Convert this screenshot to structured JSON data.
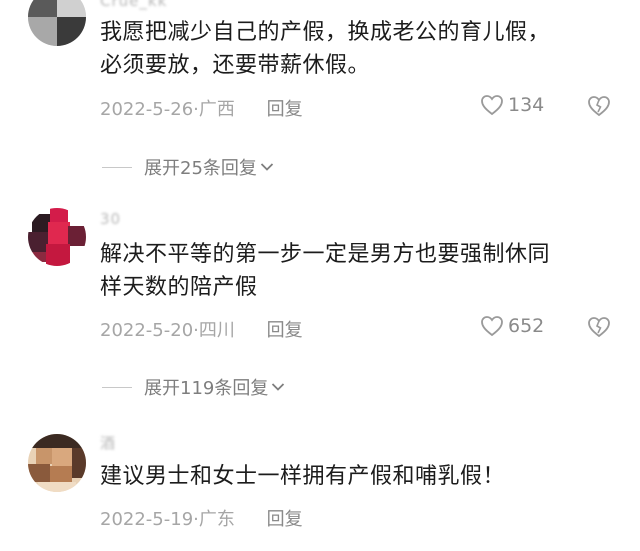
{
  "comments": [
    {
      "username": "Crue_kk",
      "text_lines": [
        "我愿把减少自己的产假，换成老公的育儿假，",
        "必须要放，还要带薪休假。"
      ],
      "date": "2022-5-26",
      "location": "广西",
      "reply_label": "回复",
      "likes": "134",
      "like_icon": "heart-outline-icon",
      "dislike_icon": "broken-heart-icon",
      "avatar_colors": [
        "#3a3a3a",
        "#8f8f8f",
        "#d9d9d9",
        "#5c5c5c"
      ],
      "expand_label": "展开25条回复"
    },
    {
      "username": "30",
      "text_lines": [
        "解决不平等的第一步一定是男方也要强制休同",
        "样天数的陪产假"
      ],
      "date": "2022-5-20",
      "location": "四川",
      "reply_label": "回复",
      "likes": "652",
      "like_icon": "heart-outline-icon",
      "dislike_icon": "broken-heart-icon",
      "avatar_colors": [
        "#d31c4a",
        "#2a1a20",
        "#6b2035",
        "#f3f3f3"
      ],
      "expand_label": "展开119条回复"
    },
    {
      "username": "酒",
      "text_lines": [
        "建议男士和女士一样拥有产假和哺乳假！"
      ],
      "date": "2022-5-19",
      "location": "广东",
      "reply_label": "回复",
      "avatar_colors": [
        "#c8956a",
        "#3b2a22",
        "#e6c9a8",
        "#8a5a3c"
      ]
    }
  ],
  "colors": {
    "text": "#1c1c1c",
    "meta": "#a6a6a6",
    "icon": "#9a9a9a"
  }
}
